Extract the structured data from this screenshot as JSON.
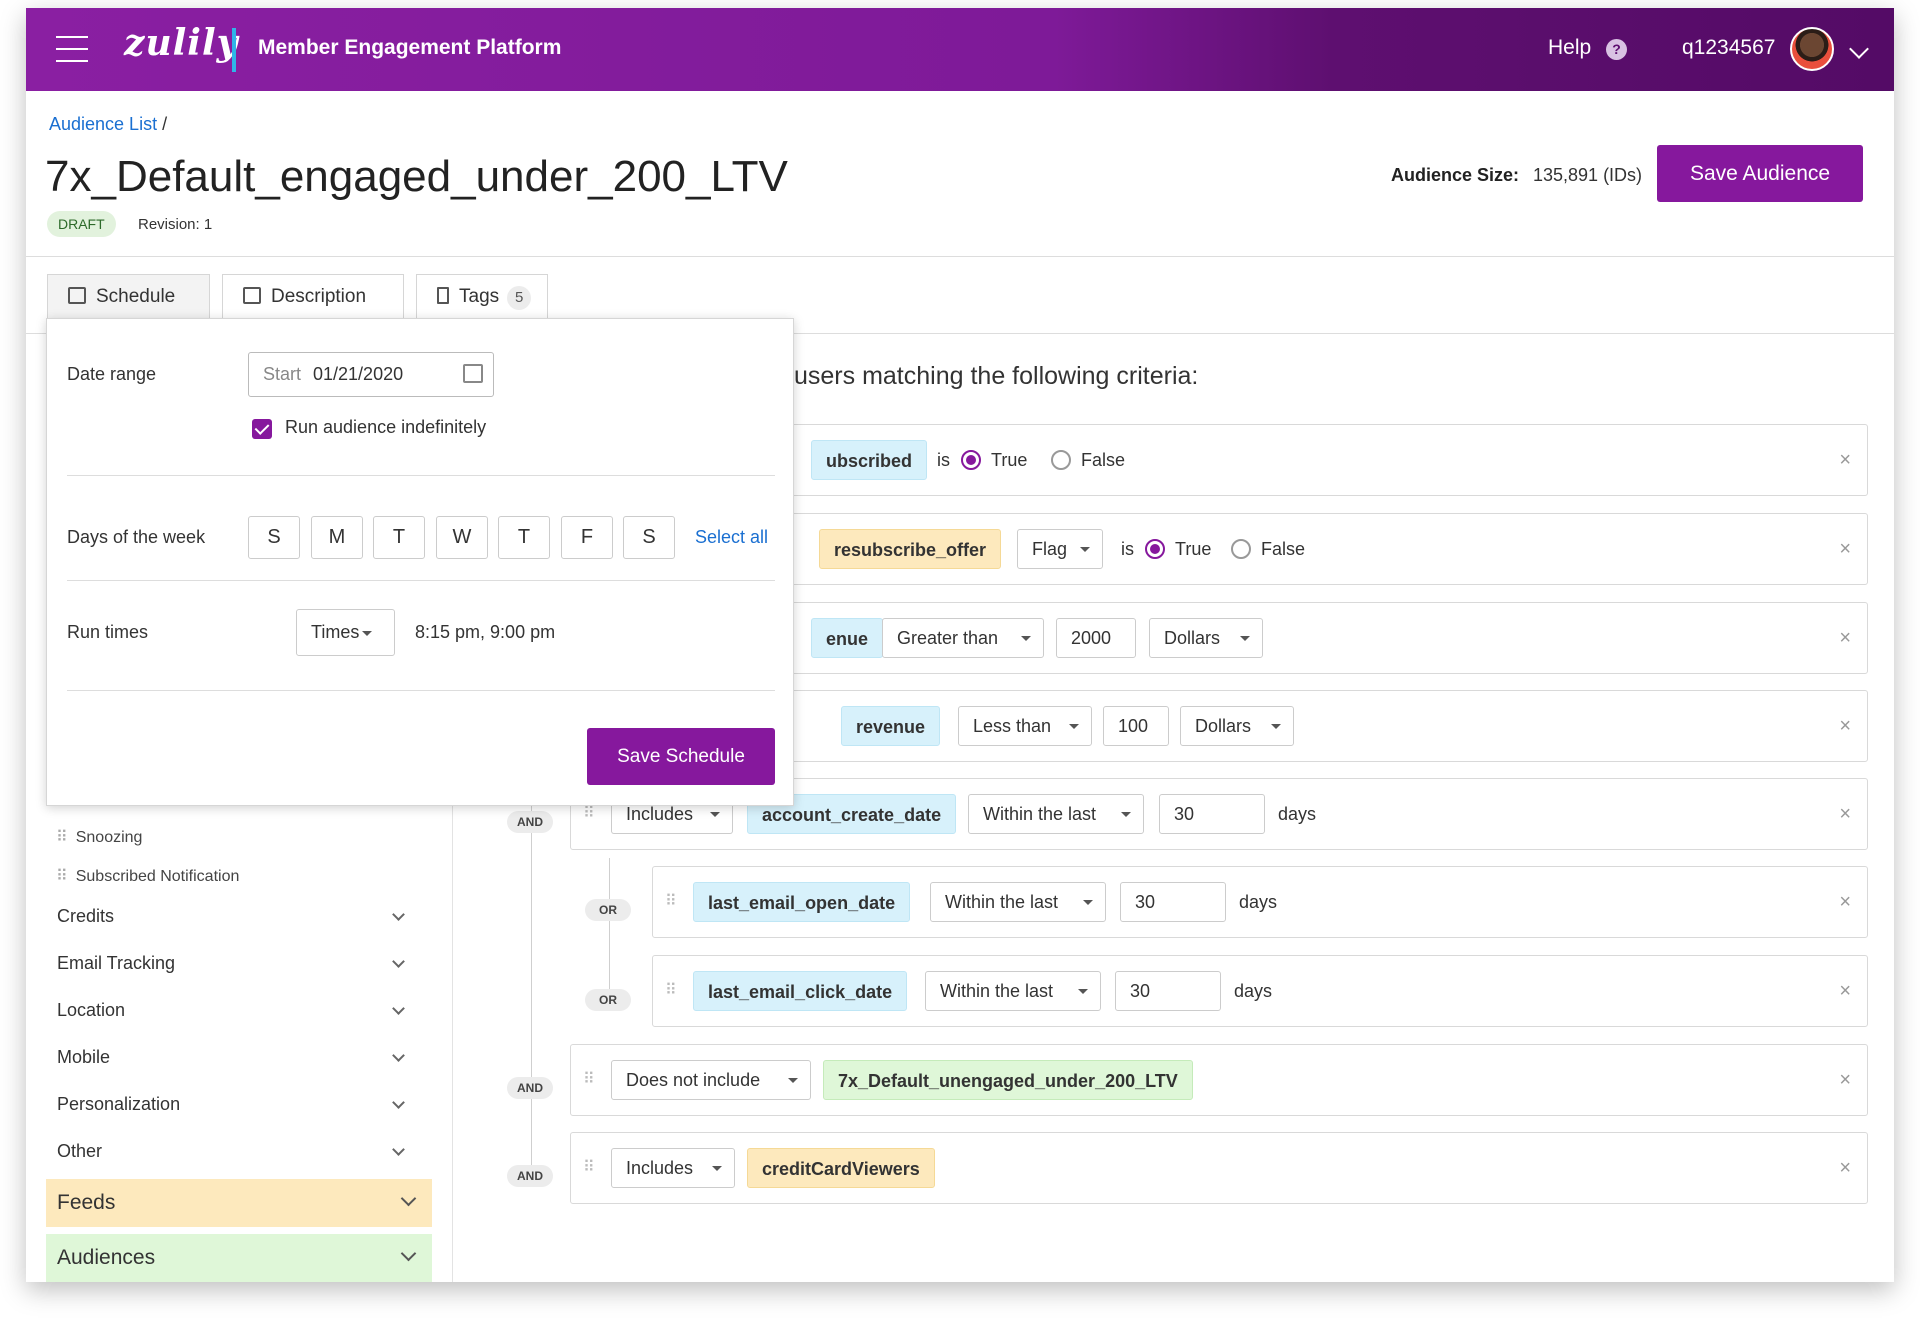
{
  "header": {
    "logo": "zulily",
    "platform": "Member Engagement Platform",
    "help": "Help",
    "help_icon": "?",
    "username": "q1234567"
  },
  "breadcrumb": {
    "link": "Audience List",
    "sep": "/"
  },
  "audience": {
    "title": "7x_Default_engaged_under_200_LTV",
    "status": "DRAFT",
    "revision": "Revision: 1",
    "size_label": "Audience Size:",
    "size_value": "135,891 (IDs)",
    "save_label": "Save Audience"
  },
  "tabs": {
    "schedule": "Schedule",
    "description": "Description",
    "tags": "Tags",
    "tags_count": "5"
  },
  "schedule": {
    "date_range_label": "Date range",
    "start_placeholder": "Start",
    "start_value": "01/21/2020",
    "indefinite_label": "Run audience indefinitely",
    "days_label": "Days of the week",
    "days": [
      "S",
      "M",
      "T",
      "W",
      "T",
      "F",
      "S"
    ],
    "select_all": "Select all",
    "run_times_label": "Run times",
    "times_select": "Times",
    "times_value": "8:15 pm, 9:00 pm",
    "save_label": "Save Schedule"
  },
  "sidebar": {
    "sub_items": [
      "Snoozing",
      "Subscribed Notification"
    ],
    "groups": [
      "Credits",
      "Email Tracking",
      "Location",
      "Mobile",
      "Personalization",
      "Other"
    ],
    "feeds": "Feeds",
    "audiences": "Audiences",
    "colors": {
      "feeds": "#fde9bd",
      "audiences": "#dff7d8"
    }
  },
  "criteria": {
    "heading": "users matching the following criteria:",
    "and": "AND",
    "or": "OR",
    "row1": {
      "chip": "ubscribed",
      "is": "is",
      "true": "True",
      "false": "False"
    },
    "row2": {
      "chip": "resubscribe_offer",
      "type": "Flag",
      "is": "is",
      "true": "True",
      "false": "False"
    },
    "row3": {
      "chip": "enue",
      "op": "Greater than",
      "value": "2000",
      "unit": "Dollars"
    },
    "row4": {
      "chip": "revenue",
      "op": "Less than",
      "value": "100",
      "unit": "Dollars"
    },
    "row5": {
      "mode": "Includes",
      "chip": "account_create_date",
      "op": "Within the last",
      "value": "30",
      "unit": "days"
    },
    "row6": {
      "chip": "last_email_open_date",
      "op": "Within the last",
      "value": "30",
      "unit": "days"
    },
    "row7": {
      "chip": "last_email_click_date",
      "op": "Within the last",
      "value": "30",
      "unit": "days"
    },
    "row8": {
      "mode": "Does not include",
      "chip": "7x_Default_unengaged_under_200_LTV"
    },
    "row9": {
      "mode": "Includes",
      "chip": "creditCardViewers"
    },
    "remove": "×"
  },
  "colors": {
    "brand": "#86189d",
    "link": "#1a6fd1",
    "accent_blue": "#2fb5e8"
  }
}
